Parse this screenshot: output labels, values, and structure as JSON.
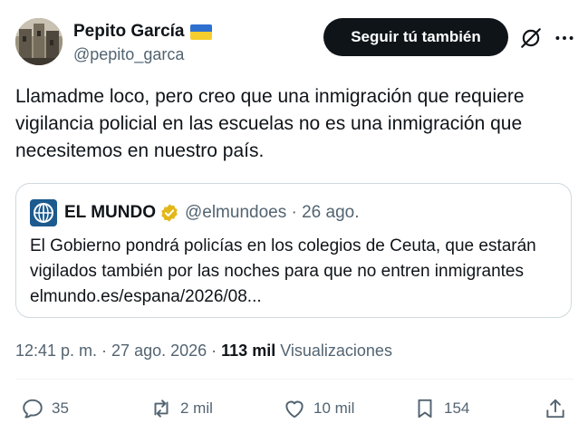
{
  "author": {
    "display_name": "Pepito García",
    "handle": "@pepito_garca",
    "flag_icon": "ukraine-flag-icon",
    "flag_colors": [
      "#2f6fd0",
      "#f6cd2e"
    ]
  },
  "header": {
    "follow_label": "Seguir tú también",
    "grok_icon": "grok-icon",
    "more_icon": "more-icon"
  },
  "tweet": {
    "text": "Llamadme loco, pero creo que una inmigración que requiere vigilancia policial en las escuelas no es una inmigración que necesitemos en nuestro país."
  },
  "quote": {
    "name": "EL MUNDO",
    "handle_date": "@elmundoes · 26 ago.",
    "verified_color": "#e2b719",
    "text": "El Gobierno pondrá policías en los colegios de Ceuta, que estarán vigilados también por las noches para que no entren inmigrantes elmundo.es/espana/2026/08..."
  },
  "meta": {
    "time_date": "12:41 p. m. · 27 ago. 2026 · ",
    "views_count": "113 mil",
    "views_label": " Visualizaciones"
  },
  "actions": {
    "replies": "35",
    "reposts": "2 mil",
    "likes": "10 mil",
    "bookmarks": "154"
  },
  "colors": {
    "text_primary": "#0f1419",
    "text_secondary": "#536471",
    "border": "#cfd9de"
  }
}
